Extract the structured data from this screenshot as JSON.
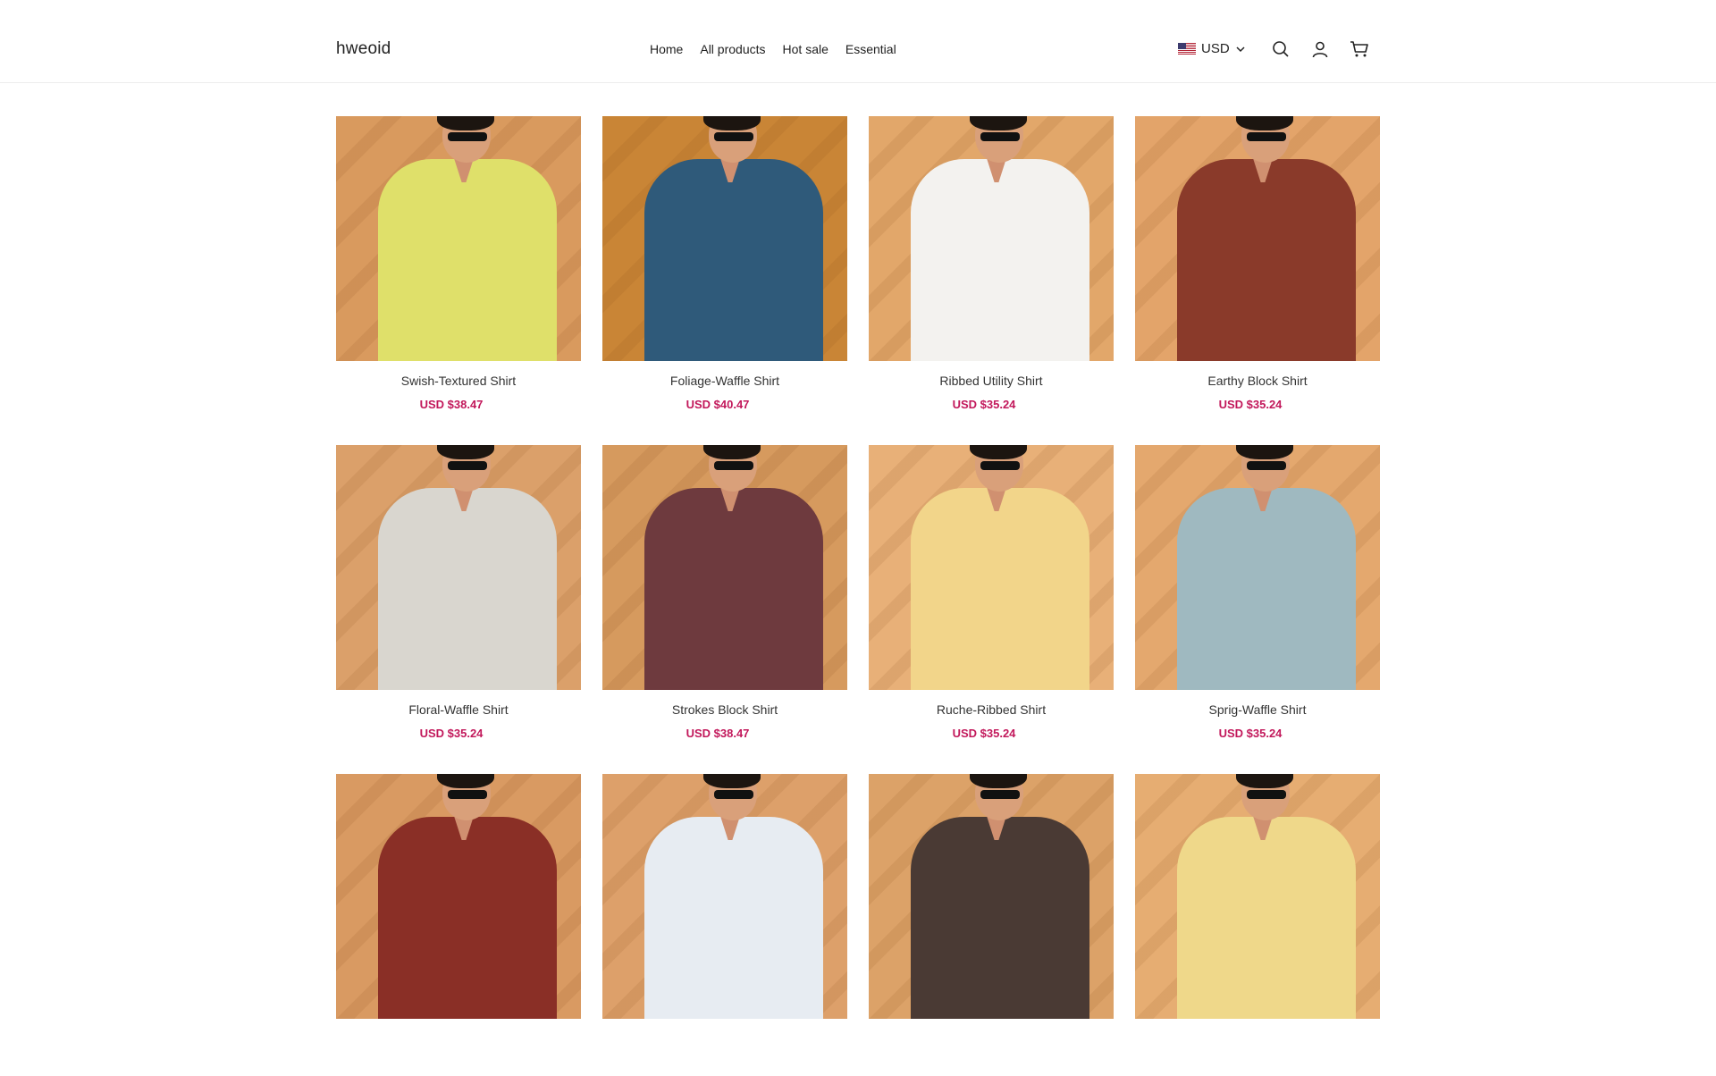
{
  "header": {
    "logo": "hweoid",
    "nav": [
      "Home",
      "All products",
      "Hot sale",
      "Essential"
    ],
    "currency": "USD"
  },
  "icons": {
    "flag": "us-flag-icon",
    "chevron": "chevron-down-icon",
    "search": "search-icon",
    "account": "user-icon",
    "cart": "cart-icon"
  },
  "colors": {
    "price": "#c2185b",
    "background": "#ffffff"
  },
  "products": [
    {
      "name": "Swish-Textured Shirt",
      "price": "USD $38.47",
      "bg": "#d99a5e",
      "shirt": "#dfe06a"
    },
    {
      "name": "Foliage-Waffle Shirt",
      "price": "USD $40.47",
      "bg": "#c98536",
      "shirt": "#2f5a7a"
    },
    {
      "name": "Ribbed Utility Shirt",
      "price": "USD $35.24",
      "bg": "#e2a76a",
      "shirt": "#f3f2ef"
    },
    {
      "name": "Earthy Block Shirt",
      "price": "USD $35.24",
      "bg": "#e3a46a",
      "shirt": "#8a3a2a"
    },
    {
      "name": "Floral-Waffle Shirt",
      "price": "USD $35.24",
      "bg": "#dba06a",
      "shirt": "#d9d6cf"
    },
    {
      "name": "Strokes Block Shirt",
      "price": "USD $38.47",
      "bg": "#d69a5e",
      "shirt": "#6e3a3e"
    },
    {
      "name": "Ruche-Ribbed Shirt",
      "price": "USD $35.24",
      "bg": "#e8b078",
      "shirt": "#f2d58a"
    },
    {
      "name": "Sprig-Waffle Shirt",
      "price": "USD $35.24",
      "bg": "#e4a86e",
      "shirt": "#9fb9c0"
    },
    {
      "name": "",
      "price": "",
      "bg": "#d99a62",
      "shirt": "#8a2f26"
    },
    {
      "name": "",
      "price": "",
      "bg": "#dda06a",
      "shirt": "#e7ecf2"
    },
    {
      "name": "",
      "price": "",
      "bg": "#dca268",
      "shirt": "#4a3a34"
    },
    {
      "name": "",
      "price": "",
      "bg": "#e6ad72",
      "shirt": "#efd88a"
    }
  ]
}
